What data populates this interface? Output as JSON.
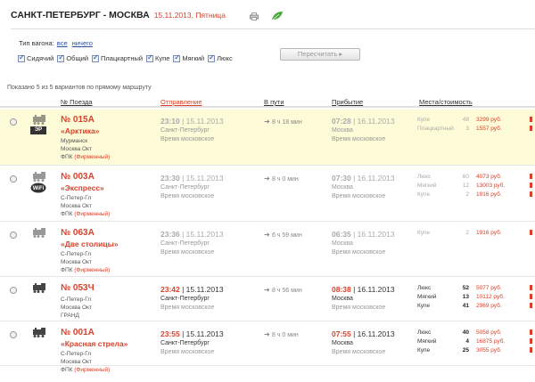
{
  "header": {
    "route": "САНКТ-ПЕТЕРБУРГ - МОСКВА",
    "date": "15.11.2013, Пятница",
    "print_icon": "printer-icon",
    "eco_icon": "leaf-icon"
  },
  "filter": {
    "label": "Тип вагона:",
    "all": "все",
    "none": "ничего",
    "types": [
      "Сидячий",
      "Общий",
      "Плацкартный",
      "Купе",
      "Мягкий",
      "Люкс"
    ],
    "recalc": "Пересчитать ▸"
  },
  "shown": "Показано 5 из 5 вариантов по прямому маршруту",
  "columns": {
    "train": "№ Поезда",
    "departure": "Отправление",
    "transit": "В пути",
    "arrival": "Прибытие",
    "seats": "Места/стоимость"
  },
  "colors": {
    "accent": "#d9412a",
    "highlight": "#fdfbd8",
    "link": "#2a4f9f"
  },
  "trains": [
    {
      "number": "№ 015А",
      "name": "«Арктика»",
      "tag": "ЭР",
      "from": "Мурманск",
      "to": "Москва Окт",
      "carrier": "ФПК",
      "brand": "(Фирменный)",
      "dep_time": "23:10",
      "dep_date": "15.11.2013",
      "dep_station": "Санкт-Петербург",
      "dep_zone": "Время московское",
      "duration": "8 ч 18 мин",
      "arr_time": "07:28",
      "arr_date": "16.11.2013",
      "arr_station": "Москва",
      "arr_zone": "Время московское",
      "seats": [
        {
          "cls": "Купе",
          "count": "48",
          "price": "3299 руб."
        },
        {
          "cls": "Плацкартный",
          "count": "3",
          "price": "1557 руб."
        }
      ]
    },
    {
      "number": "№ 003А",
      "name": "«Экспресс»",
      "tag": "WiFi",
      "from": "С-Петер-Гл",
      "to": "Москва Окт",
      "carrier": "ФПК",
      "brand": "(Фирменный)",
      "dep_time": "23:30",
      "dep_date": "15.11.2013",
      "dep_station": "Санкт-Петербург",
      "dep_zone": "Время московское",
      "duration": "8 ч 0 мин",
      "arr_time": "07:30",
      "arr_date": "16.11.2013",
      "arr_station": "Москва",
      "arr_zone": "Время московское",
      "seats": [
        {
          "cls": "Люкс",
          "count": "60",
          "price": "4073 руб."
        },
        {
          "cls": "Мягкий",
          "count": "12",
          "price": "13003 руб."
        },
        {
          "cls": "Купе",
          "count": "2",
          "price": "1916 руб."
        }
      ]
    },
    {
      "number": "№ 063А",
      "name": "«Две столицы»",
      "tag": "",
      "from": "С-Петер-Гл",
      "to": "Москва Окт",
      "carrier": "ФПК",
      "brand": "(Фирменный)",
      "dep_time": "23:36",
      "dep_date": "15.11.2013",
      "dep_station": "Санкт-Петербург",
      "dep_zone": "Время московское",
      "duration": "6 ч 59 мин",
      "arr_time": "06:35",
      "arr_date": "16.11.2013",
      "arr_station": "Москва",
      "arr_zone": "Время московское",
      "seats": [
        {
          "cls": "Купе",
          "count": "2",
          "price": "1916 руб."
        }
      ]
    },
    {
      "number": "№ 053Ч",
      "name": "",
      "tag": "",
      "from": "С-Петер-Гл",
      "to": "Москва Окт",
      "carrier": "ГРАНД",
      "brand": "",
      "dep_time": "23:42",
      "dep_date": "15.11.2013",
      "dep_station": "Санкт-Петербург",
      "dep_zone": "Время московское",
      "duration": "8 ч 56 мин",
      "arr_time": "08:38",
      "arr_date": "16.11.2013",
      "arr_station": "Москва",
      "arr_zone": "Время московское",
      "seats": [
        {
          "cls": "Люкс",
          "count": "52",
          "price": "5077 руб."
        },
        {
          "cls": "Мягкий",
          "count": "13",
          "price": "10112 руб."
        },
        {
          "cls": "Купе",
          "count": "41",
          "price": "2969 руб."
        }
      ]
    },
    {
      "number": "№ 001А",
      "name": "«Красная стрела»",
      "tag": "",
      "from": "С-Петер-Гл",
      "to": "Москва Окт",
      "carrier": "ФПК",
      "brand": "(Фирменный)",
      "dep_time": "23:55",
      "dep_date": "15.11.2013",
      "dep_station": "Санкт-Петербург",
      "dep_zone": "Время московское",
      "duration": "8 ч 0 мин",
      "arr_time": "07:55",
      "arr_date": "16.11.2013",
      "arr_station": "Москва",
      "arr_zone": "Время московское",
      "seats": [
        {
          "cls": "Люкс",
          "count": "40",
          "price": "5058 руб."
        },
        {
          "cls": "Мягкий",
          "count": "4",
          "price": "16875 руб."
        },
        {
          "cls": "Купе",
          "count": "25",
          "price": "3055 руб."
        }
      ]
    }
  ]
}
